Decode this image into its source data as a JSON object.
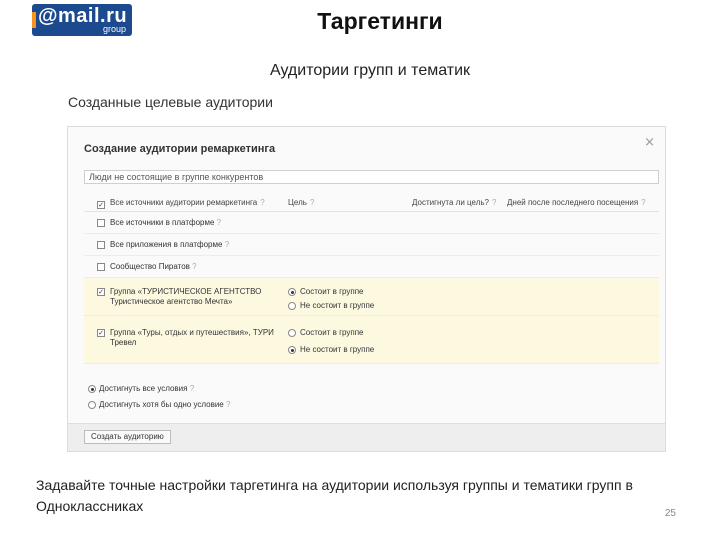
{
  "brand": {
    "logo_main": "@mail.ru",
    "logo_sub": "group",
    "colors": {
      "logo_bg": "#1c4a8e",
      "accent": "#f7931e"
    }
  },
  "slide": {
    "title": "Таргетинги",
    "subtitle": "Аудитории групп и тематик",
    "section_title": "Созданные целевые аудитории",
    "description": "Задавайте точные настройки таргетинга на аудитории используя группы и тематики групп в Одноклассниках",
    "page_number": "25"
  },
  "dialog": {
    "title": "Создание аудитории ремаркетинга",
    "close_icon": "close-icon",
    "name_value": "Люди не состоящие в группе конкурентов",
    "columns": {
      "audience": "Все источники аудитории ремаркетинга",
      "goal": "Цель",
      "reached": "Достигнута ли цель?",
      "days": "Дней после последнего посещения",
      "help": "?"
    },
    "rows": [
      {
        "label": "Все источники в платформе",
        "help": "?",
        "checked": false
      },
      {
        "label": "Все приложения в платформе",
        "help": "?",
        "checked": false
      },
      {
        "label": "Сообщество Пиратов",
        "help": "?",
        "checked": false
      },
      {
        "label": "Группа «ТУРИСТИЧЕСКОЕ АГЕНТСТВО Туристическое агентство Мечта»",
        "help": "",
        "checked": true,
        "options": [
          {
            "text": "Состоит в группе",
            "selected": true
          },
          {
            "text": "Не состоит в группе",
            "selected": false
          }
        ]
      },
      {
        "label": "Группа «Туры, отдых и путешествия», ТУРИ Тревел",
        "help": "",
        "checked": true,
        "options": [
          {
            "text": "Состоит в группе",
            "selected": false
          },
          {
            "text": "Не состоит в группе",
            "selected": true
          }
        ]
      }
    ],
    "conditions": [
      {
        "text": "Достигнуть все условия",
        "help": "?",
        "selected": true
      },
      {
        "text": "Достигнуть хотя бы одно условие",
        "help": "?",
        "selected": false
      }
    ],
    "create_button": "Создать аудиторию"
  }
}
